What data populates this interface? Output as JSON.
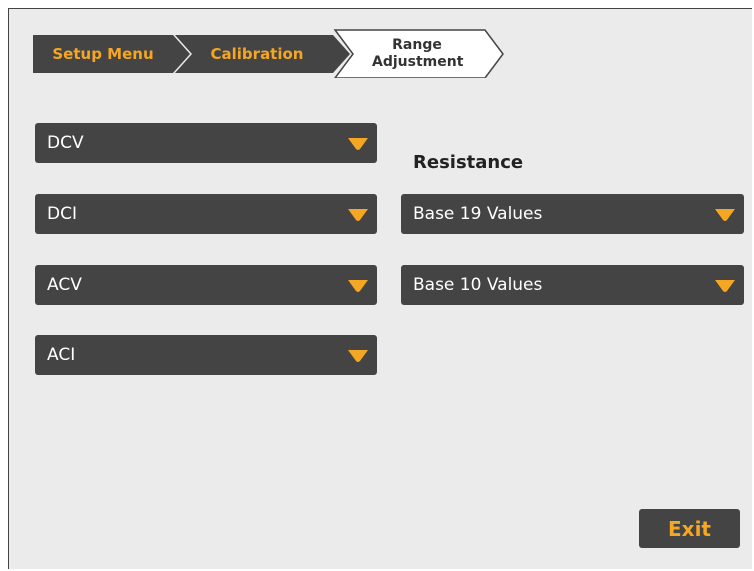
{
  "breadcrumb": {
    "items": [
      {
        "label": "Setup Menu"
      },
      {
        "label": "Calibration"
      },
      {
        "label": "Range Adjustment"
      }
    ]
  },
  "functions": [
    {
      "label": "DCV"
    },
    {
      "label": "DCI"
    },
    {
      "label": "ACV"
    },
    {
      "label": "ACI"
    }
  ],
  "resistance": {
    "title": "Resistance",
    "options": [
      {
        "label": "Base 19 Values"
      },
      {
        "label": "Base 10 Values"
      }
    ]
  },
  "exit_label": "Exit",
  "colors": {
    "accent": "#f5a623",
    "dropdown_bg": "#444444",
    "background": "#ebebeb"
  }
}
